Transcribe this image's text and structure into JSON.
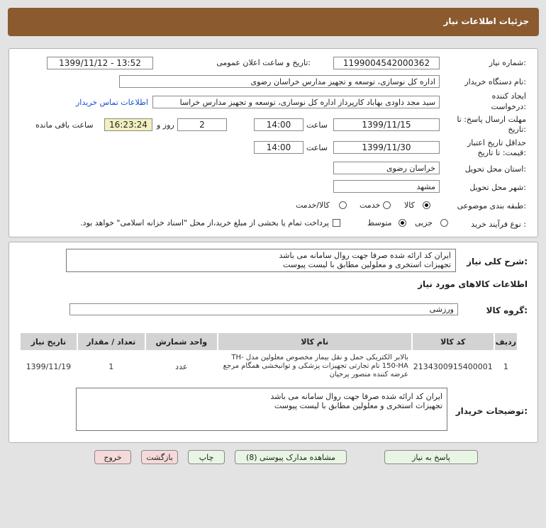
{
  "header": {
    "title": "جزئیات اطلاعات نیاز"
  },
  "form": {
    "need_number_label": "شماره نیاز:",
    "need_number": "1199004542000362",
    "announce_label": "تاریخ و ساعت اعلان عمومی:",
    "announce_value": "1399/11/12 - 13:52",
    "buyer_org_label": "نام دستگاه خریدار:",
    "buyer_org": "اداره کل نوسازی، توسعه و تجهیز مدارس خراسان رضوی",
    "creator_label": "ایجاد کننده درخواست:",
    "creator": "سید مجد داودی بهاباد کارپرداز اداره کل نوسازی، توسعه و تجهیز مدارس خراسا",
    "contact_link": "اطلاعات تماس خریدار",
    "deadline_label": "مهلت ارسال پاسخ: تا تاریخ:",
    "deadline_date": "1399/11/15",
    "time_label": "ساعت",
    "deadline_time": "14:00",
    "days_value": "2",
    "days_label": "روز و",
    "remaining_time": "16:23:24",
    "remaining_label": "ساعت باقی مانده",
    "validity_label": "حداقل تاریخ اعتبار قیمت: تا تاریخ:",
    "validity_date": "1399/11/30",
    "validity_time": "14:00",
    "province_label": "استان محل تحویل:",
    "province": "خراسان رضوی",
    "city_label": "شهر محل تحویل:",
    "city": "مشهد",
    "category_label": "طبقه بندی موضوعی:",
    "category_options": [
      "کالا",
      "خدمت",
      "کالا/خدمت"
    ],
    "category_selected": "کالا",
    "process_label": "نوع فرآیند خرید :",
    "process_options": [
      "جزیی",
      "متوسط"
    ],
    "process_selected": "متوسط",
    "payment_note": "پرداخت تمام یا بخشی از مبلغ خرید،از محل \"اسناد خزانه اسلامی\" خواهد بود."
  },
  "description": {
    "label": "شرح کلی نیاز:",
    "line1": "ایران کد ارائه شده صرفا جهت روال سامانه می باشد",
    "line2": "تجهیزات استخری و معلولین مطابق با لیست پیوست"
  },
  "goods": {
    "section_title": "اطلاعات کالاهای مورد نیاز",
    "group_label": "گروه کالا:",
    "group_value": "ورزشی",
    "columns": [
      "ردیف",
      "کد کالا",
      "نام کالا",
      "واحد شمارش",
      "تعداد / مقدار",
      "تاریخ نیاز"
    ],
    "rows": [
      {
        "index": "1",
        "code": "2134300915400001",
        "name": "بالابر الکتریکی حمل و نقل بیمار مخصوص معلولین مدل TH-150-HA نام تجارتی تجهیزات پزشکی و توانبخشی همگام مرجع عرضه کننده منصور پرحیان",
        "unit": "عدد",
        "qty": "1",
        "date": "1399/11/19"
      }
    ]
  },
  "buyer_notes": {
    "label": "توضیحات خریدار:",
    "line1": "ایران کد ارائه شده صرفا جهت روال سامانه می باشد",
    "line2": "تجهیزات استخری و معلولین مطابق با لیست پیوست"
  },
  "buttons": {
    "reply": "پاسخ به نیاز",
    "attachments": "مشاهده مدارک پیوستی (8)",
    "print": "چاپ",
    "back": "بازگشت",
    "exit": "خروج"
  },
  "colors": {
    "header": "#8b5a2f",
    "timer_bg": "#f1f0bf",
    "link": "#1a4fd0",
    "btn_green": "#e9f5e4",
    "btn_red": "#f6d9db"
  }
}
